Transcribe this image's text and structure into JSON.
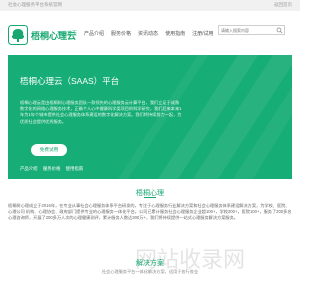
{
  "topbar": {
    "tagline": "社会心理服务平台系统官网",
    "home_link": "返回首页"
  },
  "brand": {
    "name": "梧桐心理云",
    "accent": "#16a870"
  },
  "nav": {
    "items": [
      "平台首页",
      "产品介绍",
      "服务价格",
      "资讯动态",
      "使用指南",
      "注册/试用"
    ],
    "active_index": 0
  },
  "search": {
    "placeholder": "请输入搜索内容",
    "icon": "search-icon"
  },
  "hero": {
    "title": "梧桐心理云（SAAS）平台",
    "description": "梧桐心理云是由梧桐树心理服务团队一款领先的心理服务云计算平台，我们立足于成熟数字化的网络心理服务技术，正确个人心中健康科学类项目的科学研究，我们后来本来1年为1年个城市提供社会心理服务体系建设的数字化解决方案。我们将持续努力一起，为优质社会提供优秀服务。",
    "button_label": "免费试用",
    "links": [
      "产品介绍",
      "服务价格",
      "使用指南"
    ]
  },
  "about": {
    "title": "梧桐心理",
    "text": "梧桐树心理成立于2016年，在专业从事社会心理服务体系平台研发的，专注于心理服务行业解决方案和社会心理服务体系建设解决方案，为学校、医院、心理公司 机构、心理协会、政府部门提供专业的心理服务一体化平台。公司已累计服务社会心理服务企业超100+，学校200+，医院100+，服务了200多名心理咨询师，开展了200多万人次的心理健康测评，累计服务人数达300万+，我们将持续提供一站式心理服务解决方案服务。"
  },
  "solution": {
    "title": "解决方案",
    "subtitle": "社会心理服务平台一体化解决方案，适用于各行各业"
  },
  "watermark": {
    "text": "网站收录网"
  }
}
